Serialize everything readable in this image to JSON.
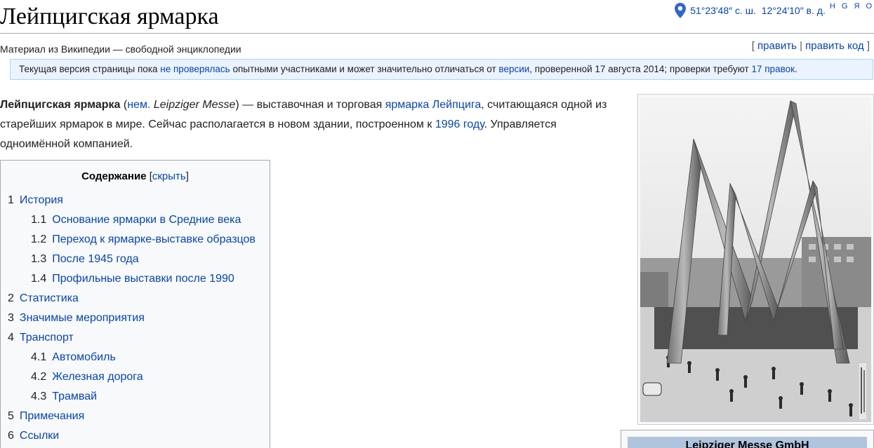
{
  "page": {
    "title": "Лейпцигская ярмарка",
    "tagline": "Материал из Википедии — свободной энциклопедии"
  },
  "coords": {
    "lat": "51°23′48″ с. ш.",
    "lon": "12°24′10″ в. д.",
    "map_links": "H G Я O",
    "icon": "map-pin-icon"
  },
  "edit": {
    "open": "[",
    "edit_label": "править",
    "sep": "|",
    "edit_source_label": "править код",
    "close": "]"
  },
  "review": {
    "prefix": "Текущая версия страницы пока ",
    "link1": "не проверялась",
    "middle": " опытными участниками и может значительно отличаться от ",
    "link2": "версии",
    "middle2": ", проверенной 17 августа 2014; проверки требуют ",
    "link3": "17 правок",
    "suffix": "."
  },
  "lead": {
    "bold": "Лейпцигская ярмарка",
    "p1": " (",
    "lang_link": "нем.",
    "p2": " ",
    "italic": "Leipziger Messe",
    "p3": ") — выставочная и торговая ",
    "link_fair": "ярмарка",
    "p4": " ",
    "link_city": "Лейпцига",
    "p5": ", считающаяся одной из старейших ярмарок в мире. Сейчас располагается в новом здании, построенном к ",
    "link_year": "1996 году",
    "p6": ". Управляется одноимённой компанией."
  },
  "toc": {
    "title": "Содержание",
    "open": "[",
    "hide_label": "скрыть",
    "close": "]",
    "items": [
      {
        "num": "1",
        "label": "История",
        "level": 1
      },
      {
        "num": "1.1",
        "label": "Основание ярмарки в Средние века",
        "level": 2
      },
      {
        "num": "1.2",
        "label": "Переход к ярмарке-выставке образцов",
        "level": 2
      },
      {
        "num": "1.3",
        "label": "После 1945 года",
        "level": 2
      },
      {
        "num": "1.4",
        "label": "Профильные выставки после 1990",
        "level": 2
      },
      {
        "num": "2",
        "label": "Статистика",
        "level": 1
      },
      {
        "num": "3",
        "label": "Значимые мероприятия",
        "level": 1
      },
      {
        "num": "4",
        "label": "Транспорт",
        "level": 1
      },
      {
        "num": "4.1",
        "label": "Автомобиль",
        "level": 2
      },
      {
        "num": "4.2",
        "label": "Железная дорога",
        "level": 2
      },
      {
        "num": "4.3",
        "label": "Трамвай",
        "level": 2
      },
      {
        "num": "5",
        "label": "Примечания",
        "level": 1
      },
      {
        "num": "6",
        "label": "Ссылки",
        "level": 1
      }
    ]
  },
  "infobox": {
    "title": "Leipziger Messe GmbH"
  },
  "colors": {
    "link": "#0645ad",
    "review_bg": "#eaf3ff",
    "toc_bg": "#f8f9fa",
    "infobox_header": "#b0c4de"
  }
}
